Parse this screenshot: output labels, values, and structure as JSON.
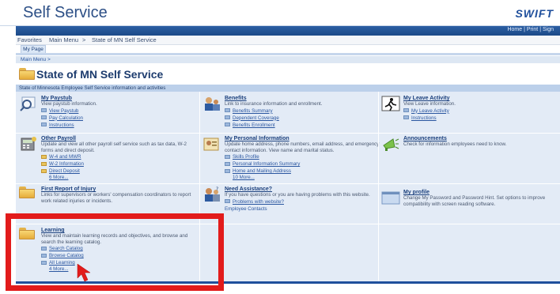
{
  "app": {
    "title": "Self Service",
    "brand": "SWIFT"
  },
  "top_links": [
    "Home",
    "Print",
    "Sign"
  ],
  "nav": {
    "items": [
      "Favorites",
      "Main Menu",
      ">",
      "State of MN Self Service"
    ]
  },
  "tabs": [
    "My Page"
  ],
  "breadcrumb": "Main Menu >",
  "page": {
    "title": "State of MN Self Service",
    "description": "State of Minnesota Employee Self Service information and activities"
  },
  "tiles": {
    "paystub": {
      "title": "My Paystub",
      "desc": "View paystub information.",
      "links": [
        "View Paystub",
        "Pay Calculation",
        "Instructions"
      ]
    },
    "benefits": {
      "title": "Benefits",
      "desc": "Link to insurance information and enrollment.",
      "links": [
        "Benefits Summary",
        "Dependent Coverage",
        "Benefits Enrollment"
      ]
    },
    "leave": {
      "title": "My Leave Activity",
      "desc": "View Leave information.",
      "links": [
        "My Leave Activity",
        "Instructions"
      ]
    },
    "other_payroll": {
      "title": "Other Payroll",
      "desc": "Update and view all other payroll self service such as tax data, W-2 forms and direct deposit.",
      "links": [
        "W-4 and MWR",
        "W-2 Information",
        "Direct Deposit"
      ],
      "more": "6 More..."
    },
    "personal": {
      "title": "My Personal Information",
      "desc": "Update home address, phone numbers, email address, and emergency contact information. View name and marital status.",
      "links": [
        "Skills Profile",
        "Personal Information Summary",
        "Home and Mailing Address"
      ],
      "more": "10 More..."
    },
    "announcements": {
      "title": "Announcements",
      "desc": "Check for information employees need to know."
    },
    "injury": {
      "title": "First Report of Injury",
      "desc": "Links for supervisors or workers' compensation coordinators to report work related injuries or incidents."
    },
    "assistance": {
      "title": "Need Assistance?",
      "desc": "If you have questions or you are having problems with this website.",
      "links": [
        "Problems with website?",
        "Employee Contacts"
      ]
    },
    "profile": {
      "title": "My profile",
      "desc": "Change My Password and Password Hint. Set options to improve compatibility with screen reading software."
    },
    "learning": {
      "title": "Learning",
      "desc": "View and maintain learning records and objectives, and browse and search the learning catalog.",
      "links": [
        "Search Catalog",
        "Browse Catalog",
        "All Learning"
      ],
      "more": "4 More..."
    }
  },
  "colors": {
    "highlight": "#e21b1b",
    "accent": "#1f4f9c",
    "grid_bg": "#e3ebf6"
  }
}
